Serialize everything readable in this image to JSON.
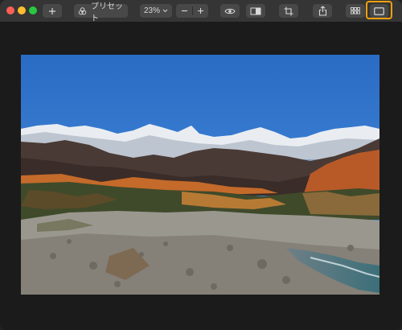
{
  "window": {
    "traffic_lights": [
      "#fe5f57",
      "#febc2e",
      "#28c840"
    ]
  },
  "toolbar": {
    "add_icon": "plus-icon",
    "preset_label": "プリセット",
    "zoom_value": "23%",
    "zoom_out_icon": "minus-icon",
    "zoom_in_icon": "plus-icon",
    "eye_icon": "eye-icon",
    "compare_icon": "split-compare-icon",
    "crop_icon": "crop-icon",
    "share_icon": "share-icon",
    "grid_icon": "grid-icon",
    "single_view_icon": "single-view-icon",
    "highlight_color": "#f2a10c"
  },
  "photo": {
    "description_icon": "landscape-photo"
  }
}
